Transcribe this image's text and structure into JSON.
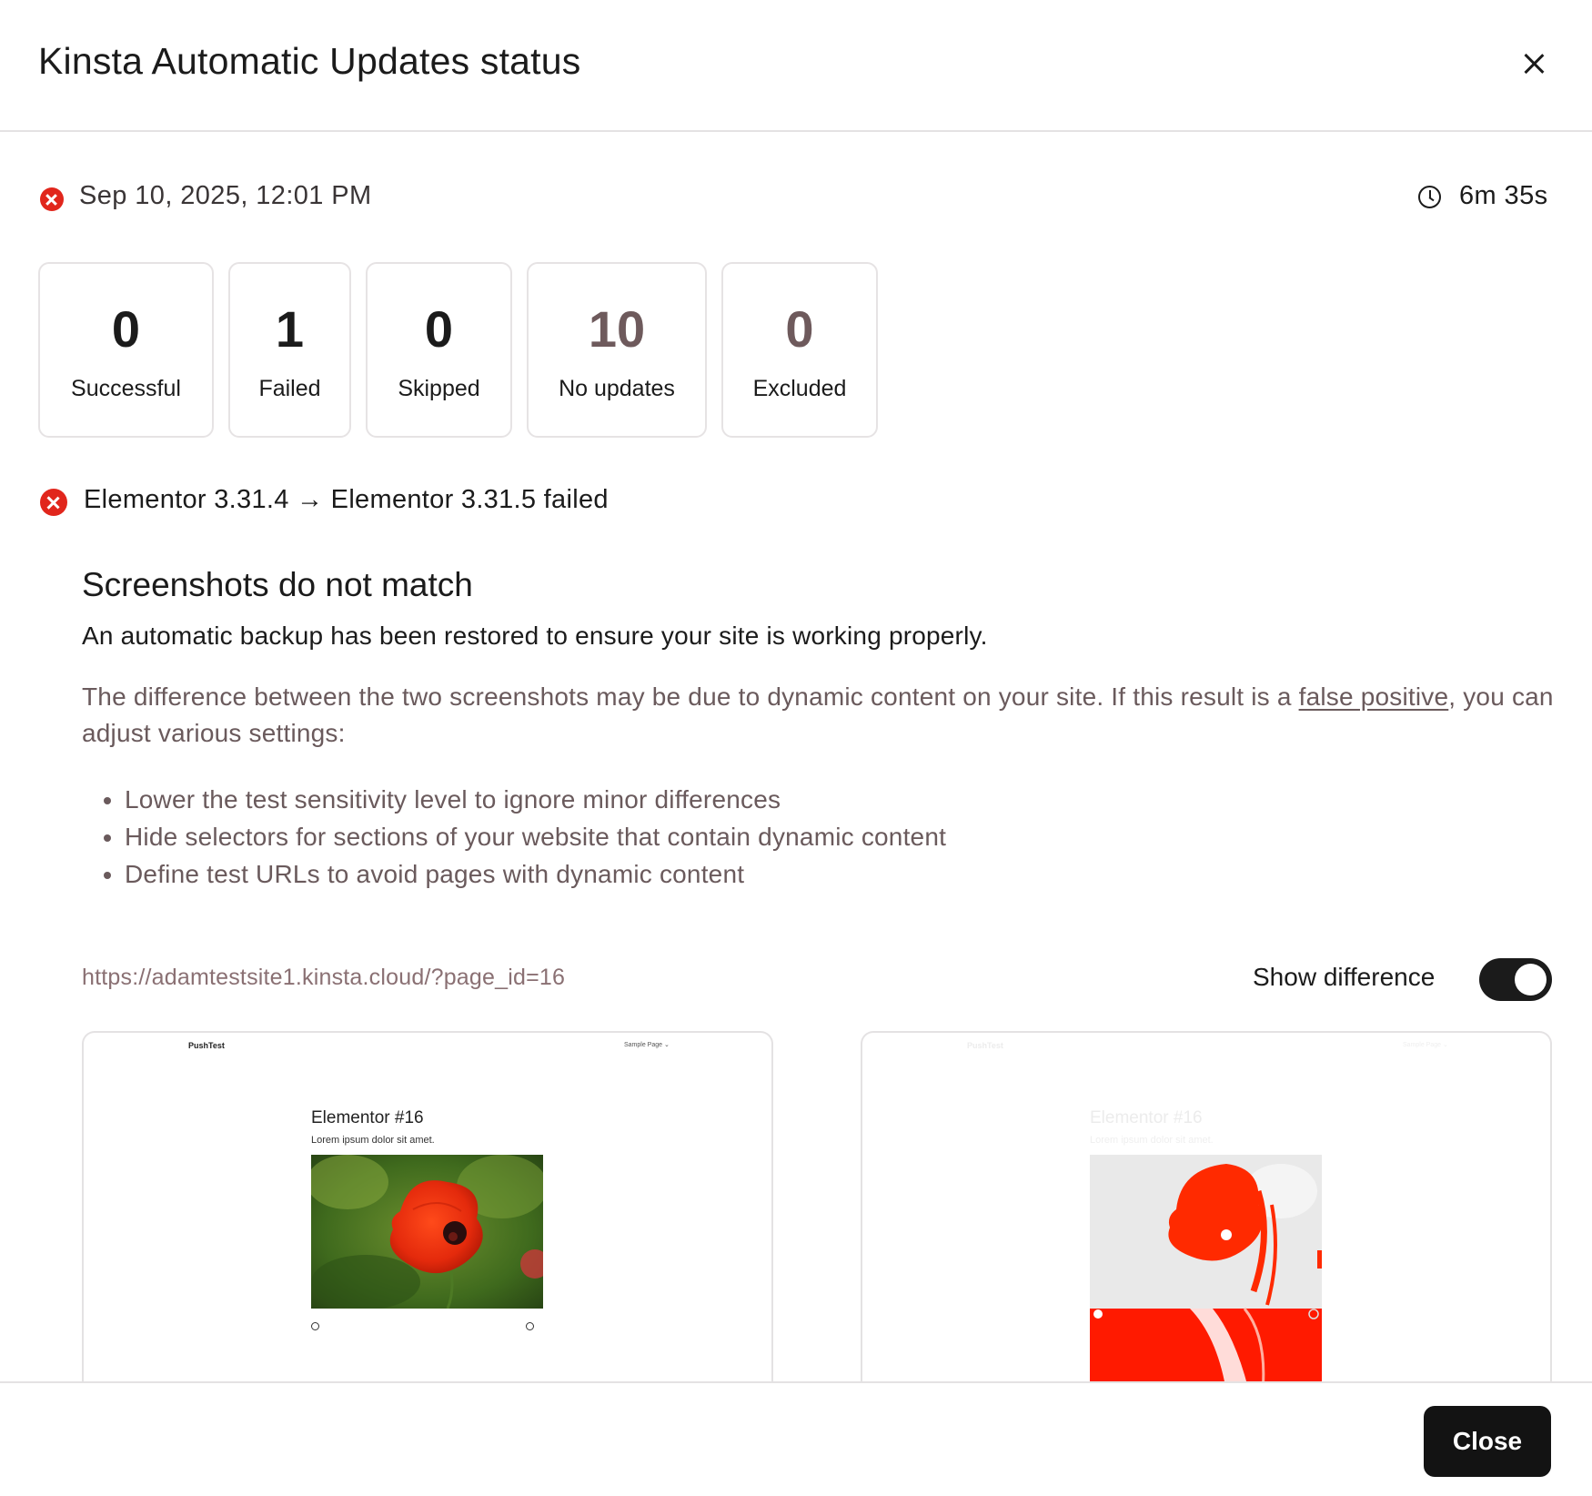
{
  "modal": {
    "title": "Kinsta Automatic Updates status",
    "close_icon": "close-icon"
  },
  "run": {
    "date": "Sep 10, 2025, 12:01 PM",
    "duration": "6m 35s",
    "status_icon": "error-icon",
    "duration_icon": "clock-icon"
  },
  "stats": [
    {
      "value": "0",
      "label": "Successful",
      "color": "#1b1b1b"
    },
    {
      "value": "1",
      "label": "Failed",
      "color": "#1b1b1b"
    },
    {
      "value": "0",
      "label": "Skipped",
      "color": "#1b1b1b"
    },
    {
      "value": "10",
      "label": "No updates",
      "color": "#6e5a5c"
    },
    {
      "value": "0",
      "label": "Excluded",
      "color": "#6e5a5c"
    }
  ],
  "failure": {
    "summary": "Elementor 3.31.4 → Elementor 3.31.5 failed",
    "heading": "Screenshots do not match",
    "restored_text": "An automatic backup has been restored to ensure your site is working properly.",
    "explanation_before": "The difference between the two screenshots may be due to dynamic content on your site. If this result is a ",
    "explanation_link": "false positive",
    "explanation_after": ", you can adjust various settings:",
    "tips": [
      "Lower the test sensitivity level to ignore minor differences",
      "Hide selectors for sections of your website that contain dynamic content",
      "Define test URLs to avoid pages with dynamic content"
    ]
  },
  "comparison": {
    "url": "https://adamtestsite1.kinsta.cloud/?page_id=16",
    "show_difference_label": "Show difference",
    "show_difference_on": true,
    "site_name": "PushTest",
    "site_nav": "Sample Page ⌄",
    "page_heading": "Elementor #16",
    "page_text": "Lorem ipsum dolor sit amet."
  },
  "footer": {
    "close_label": "Close"
  },
  "colors": {
    "error": "#e1261c",
    "primary_button": "#131313",
    "muted_text": "#6a5a5c",
    "diff_highlight": "#ff1a00"
  }
}
